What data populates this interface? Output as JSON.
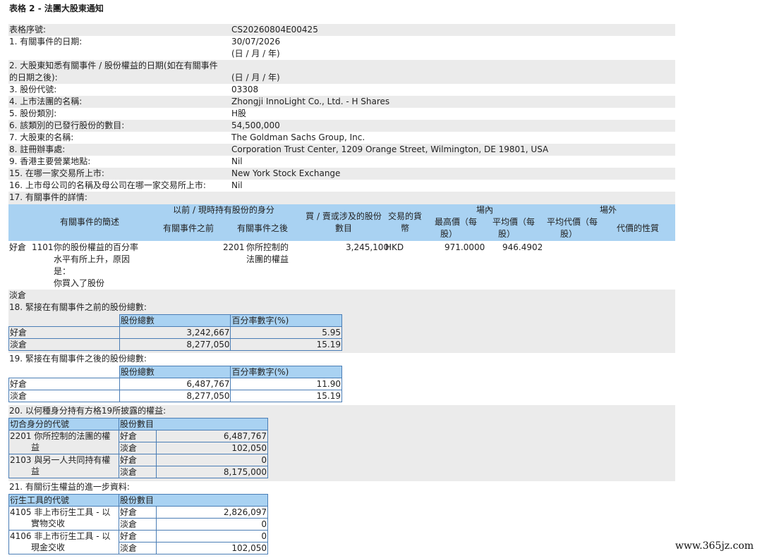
{
  "title": "表格 2 - 法團大股東通知",
  "fields": [
    {
      "label": "表格序號:",
      "value": "CS20260804E00425"
    },
    {
      "label": "1. 有關事件的日期:",
      "value": "30/07/2026",
      "value2": "(日 / 月 / 年)"
    },
    {
      "label": "2. 大股東知悉有關事件 / 股份權益的日期(如在有關事件",
      "label2": "的日期之後):",
      "value": "",
      "value2": "(日 / 月 / 年)"
    },
    {
      "label": "3. 股份代號:",
      "value": "03308"
    },
    {
      "label": "4. 上市法團的名稱:",
      "value": "Zhongji InnoLight Co., Ltd. - H Shares"
    },
    {
      "label": "5. 股份類別:",
      "value": "H股"
    },
    {
      "label": "6. 該類別的已發行股份的數目:",
      "value": "54,500,000"
    },
    {
      "label": "7. 大股東的名稱:",
      "value": "The Goldman Sachs Group, Inc."
    },
    {
      "label": "8. 註冊辦事處:",
      "value": "Corporation Trust Center, 1209 Orange Street, Wilmington, DE 19801, USA"
    },
    {
      "label": "9. 香港主要營業地點:",
      "value": "Nil"
    },
    {
      "label": "15. 在哪一家交易所上市:",
      "value": "New York Stock Exchange"
    },
    {
      "label": "16. 上市母公司的名稱及母公司在哪一家交易所上市:",
      "value": "Nil"
    },
    {
      "label": "17. 有關事件的詳情:",
      "value": ""
    }
  ],
  "s17_header": {
    "desc": "有關事件的簡述",
    "capacity": "以前 / 現時持有股份的身分",
    "before": "有關事件之前",
    "after": "有關事件之後",
    "shares_l1": "買 / 賣或涉及的股份",
    "shares_l2": "數目",
    "cur_l1": "交易的貨",
    "cur_l2": "幣",
    "onex": "場內",
    "offex": "場外",
    "high_l1": "最高價（每",
    "high_l2": "股）",
    "avg_l1": "平均價（每",
    "avg_l2": "股）",
    "offavg_l1": "平均代價（每",
    "offavg_l2": "股）",
    "nature": "代價的性質"
  },
  "s17_event": {
    "position": "好倉",
    "code": "1101",
    "desc_lines": [
      "你的股份權益的百分率",
      "水平有所上升，原因",
      "是：",
      "你買入了股份"
    ],
    "after_code": "2201",
    "after_lines": [
      "你所控制的",
      "法團的權益"
    ],
    "shares": "3,245,100",
    "currency": "HKD",
    "high": "971.0000",
    "avg": "946.4902"
  },
  "short_label": "淡倉",
  "s18": {
    "title": "18. 緊接在有關事件之前的股份總數:",
    "h_shares": "股份總數",
    "h_pct": "百分率數字(%)",
    "rows": [
      {
        "pos": "好倉",
        "shares": "3,242,667",
        "pct": "5.95"
      },
      {
        "pos": "淡倉",
        "shares": "8,277,050",
        "pct": "15.19"
      }
    ]
  },
  "s19": {
    "title": "19. 緊接在有關事件之後的股份總數:",
    "h_shares": "股份總數",
    "h_pct": "百分率數字(%)",
    "rows": [
      {
        "pos": "好倉",
        "shares": "6,487,767",
        "pct": "11.90"
      },
      {
        "pos": "淡倉",
        "shares": "8,277,050",
        "pct": "15.19"
      }
    ]
  },
  "s20": {
    "title": "20. 以何種身分持有方格19所披露的權益:",
    "h_code": "切合身分的代號",
    "h_count": "股份數目",
    "groups": [
      {
        "code": "2201",
        "l1": "你所控制的法團的權",
        "l2": "益",
        "p1": "好倉",
        "v1": "6,487,767",
        "p2": "淡倉",
        "v2": "102,050"
      },
      {
        "code": "2103",
        "l1": "與另一人共同持有權",
        "l2": "益",
        "p1": "好倉",
        "v1": "0",
        "p2": "淡倉",
        "v2": "8,175,000"
      }
    ]
  },
  "s21": {
    "title": "21. 有關衍生權益的進一步資料:",
    "h_code": "衍生工具的代號",
    "h_count": "股份數目",
    "groups": [
      {
        "code": "4105",
        "l1": "非上市衍生工具 - 以",
        "l2": "實物交收",
        "p1": "好倉",
        "v1": "2,826,097",
        "p2": "淡倉",
        "v2": "0"
      },
      {
        "code": "4106",
        "l1": "非上市衍生工具 - 以",
        "l2": "現金交收",
        "p1": "好倉",
        "v1": "0",
        "p2": "淡倉",
        "v2": "102,050"
      }
    ]
  },
  "watermark": "www.365jz.com"
}
